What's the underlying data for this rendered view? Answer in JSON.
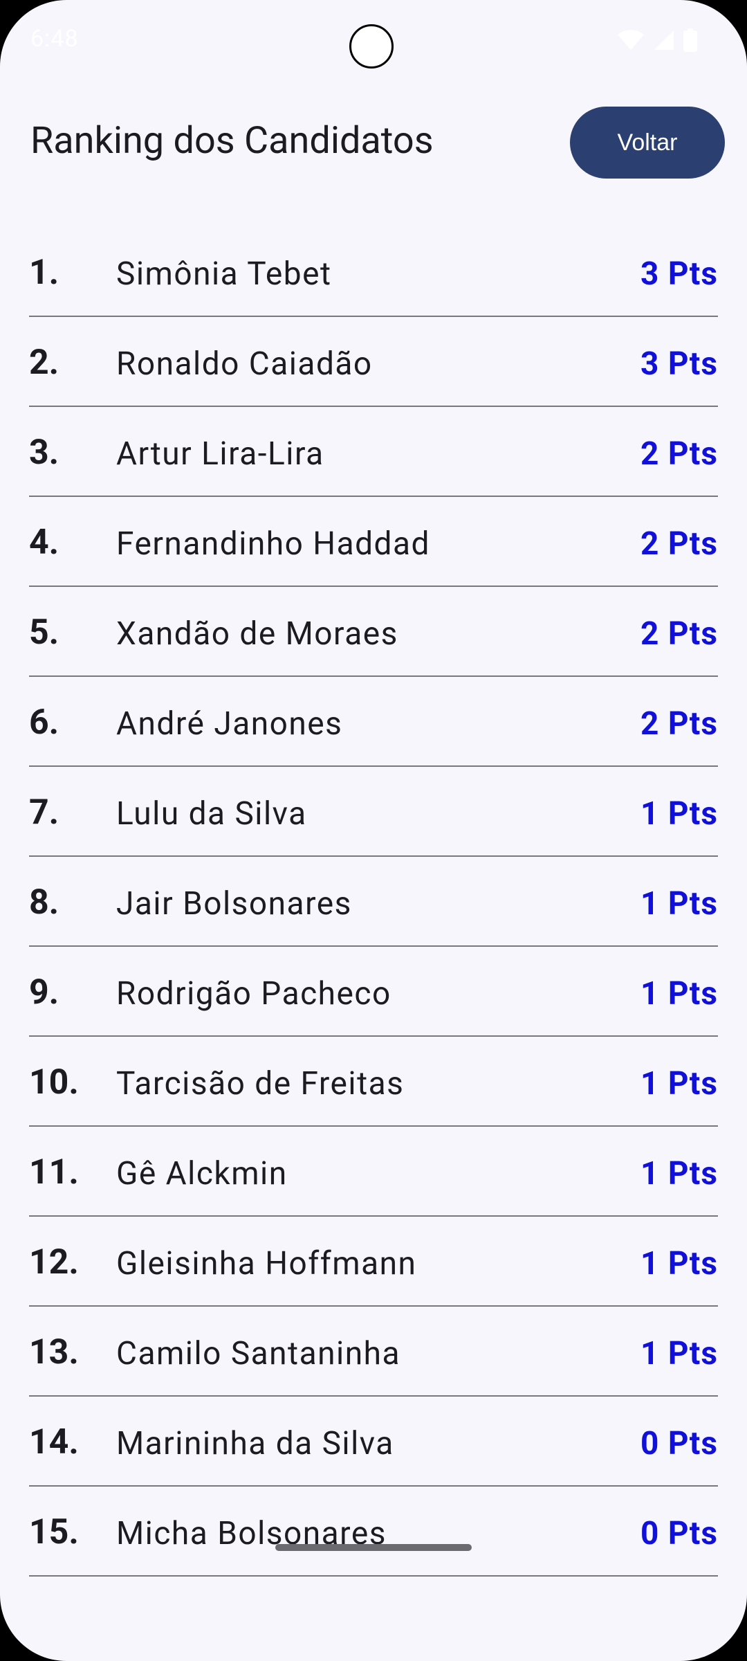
{
  "status_bar": {
    "time": "6:48",
    "icons": [
      "wifi-icon",
      "signal-icon",
      "battery-icon"
    ]
  },
  "header": {
    "title": "Ranking dos Candidatos",
    "back_label": "Voltar"
  },
  "colors": {
    "background": "#f7f6fc",
    "button": "#2b3f70",
    "points": "#1010d8",
    "divider": "#79767d"
  },
  "ranking": [
    {
      "position": "1.",
      "name": "Simônia Tebet",
      "points": "3 Pts"
    },
    {
      "position": "2.",
      "name": "Ronaldo Caiadão",
      "points": "3 Pts"
    },
    {
      "position": "3.",
      "name": "Artur Lira-Lira",
      "points": "2 Pts"
    },
    {
      "position": "4.",
      "name": "Fernandinho Haddad",
      "points": "2 Pts"
    },
    {
      "position": "5.",
      "name": "Xandão de Moraes",
      "points": "2 Pts"
    },
    {
      "position": "6.",
      "name": "André Janones",
      "points": "2 Pts"
    },
    {
      "position": "7.",
      "name": "Lulu da Silva",
      "points": "1 Pts"
    },
    {
      "position": "8.",
      "name": "Jair Bolsonares",
      "points": "1 Pts"
    },
    {
      "position": "9.",
      "name": "Rodrigão Pacheco",
      "points": "1 Pts"
    },
    {
      "position": "10.",
      "name": "Tarcisão de Freitas",
      "points": "1 Pts"
    },
    {
      "position": "11.",
      "name": "Gê Alckmin",
      "points": "1 Pts"
    },
    {
      "position": "12.",
      "name": "Gleisinha Hoffmann",
      "points": "1 Pts"
    },
    {
      "position": "13.",
      "name": "Camilo Santaninha",
      "points": "1 Pts"
    },
    {
      "position": "14.",
      "name": "Marininha da Silva",
      "points": "0 Pts"
    },
    {
      "position": "15.",
      "name": "Micha Bolsonares",
      "points": "0 Pts"
    }
  ]
}
